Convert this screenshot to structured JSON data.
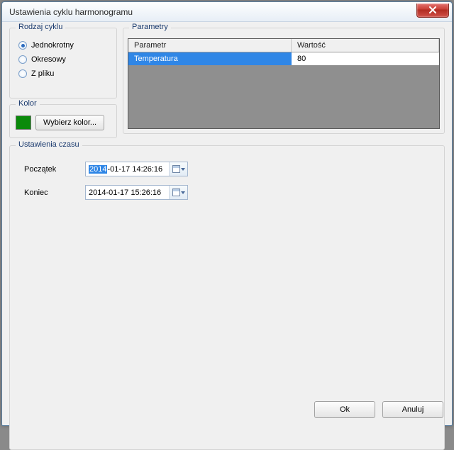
{
  "window": {
    "title": "Ustawienia cyklu harmonogramu"
  },
  "cycleType": {
    "legend": "Rodzaj cyklu",
    "options": {
      "single": "Jednokrotny",
      "periodic": "Okresowy",
      "fromFile": "Z pliku"
    },
    "selected": "single"
  },
  "color": {
    "legend": "Kolor",
    "swatch": "#0a8a0a",
    "button": "Wybierz kolor..."
  },
  "params": {
    "legend": "Parametry",
    "columns": {
      "param": "Parametr",
      "value": "Wartość"
    },
    "rows": [
      {
        "param": "Temperatura",
        "value": "80"
      }
    ]
  },
  "time": {
    "legend": "Ustawienia czasu",
    "start": {
      "label": "Początek",
      "year": "2014",
      "rest": "-01-17 14:26:16"
    },
    "end": {
      "label": "Koniec",
      "value": "2014-01-17 15:26:16"
    }
  },
  "footer": {
    "ok": "Ok",
    "cancel": "Anuluj"
  }
}
